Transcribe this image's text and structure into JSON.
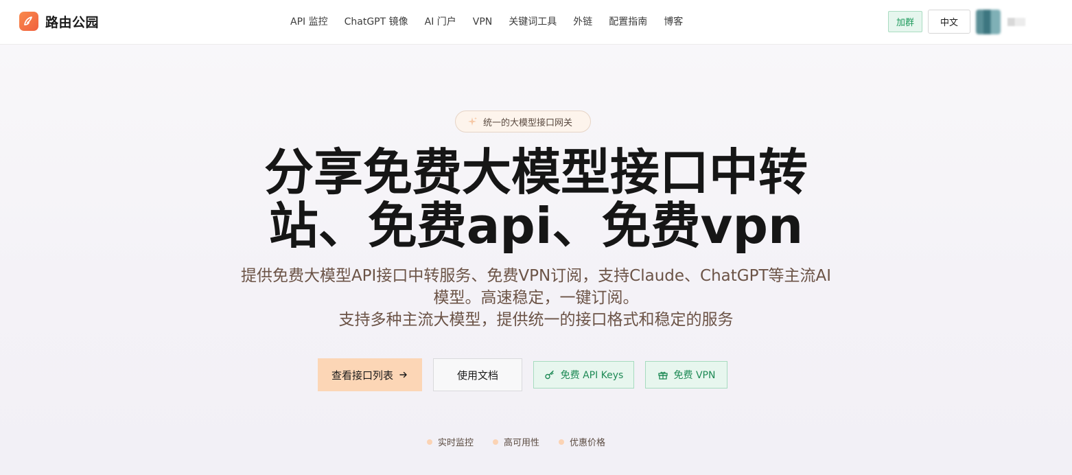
{
  "brand": {
    "name": "路由公园"
  },
  "nav": {
    "items": [
      {
        "label": "API 监控"
      },
      {
        "label": "ChatGPT 镜像"
      },
      {
        "label": "AI 门户"
      },
      {
        "label": "VPN"
      },
      {
        "label": "关键词工具"
      },
      {
        "label": "外链"
      },
      {
        "label": "配置指南"
      },
      {
        "label": "博客"
      }
    ]
  },
  "header_actions": {
    "join_label": "加群",
    "lang_label": "中文"
  },
  "hero": {
    "badge": "统一的大模型接口网关",
    "title_line1": "分享免费大模型接口中转",
    "title_line2": "站、免费api、免费vpn",
    "subtitle_line1": "提供免费大模型API接口中转服务、免费VPN订阅，支持Claude、ChatGPT等主流AI",
    "subtitle_line2": "模型。高速稳定，一键订阅。",
    "subtitle_line3": "支持多种主流大模型，提供统一的接口格式和稳定的服务"
  },
  "cta": {
    "primary_label": "查看接口列表",
    "secondary_label": "使用文档",
    "keys_label": "免费 API Keys",
    "vpn_label": "免费 VPN"
  },
  "features": [
    {
      "label": "实时监控"
    },
    {
      "label": "高可用性"
    },
    {
      "label": "优惠价格"
    }
  ],
  "colors": {
    "brand_orange": "#f26b3f",
    "primary_button": "#fcd6b6",
    "green_accent": "#1f8a56"
  },
  "icons": {
    "logo": "bird-logo-icon",
    "badge": "sparkle-icon",
    "arrow": "arrow-right-icon",
    "keys": "key-icon",
    "vpn": "gift-icon"
  }
}
